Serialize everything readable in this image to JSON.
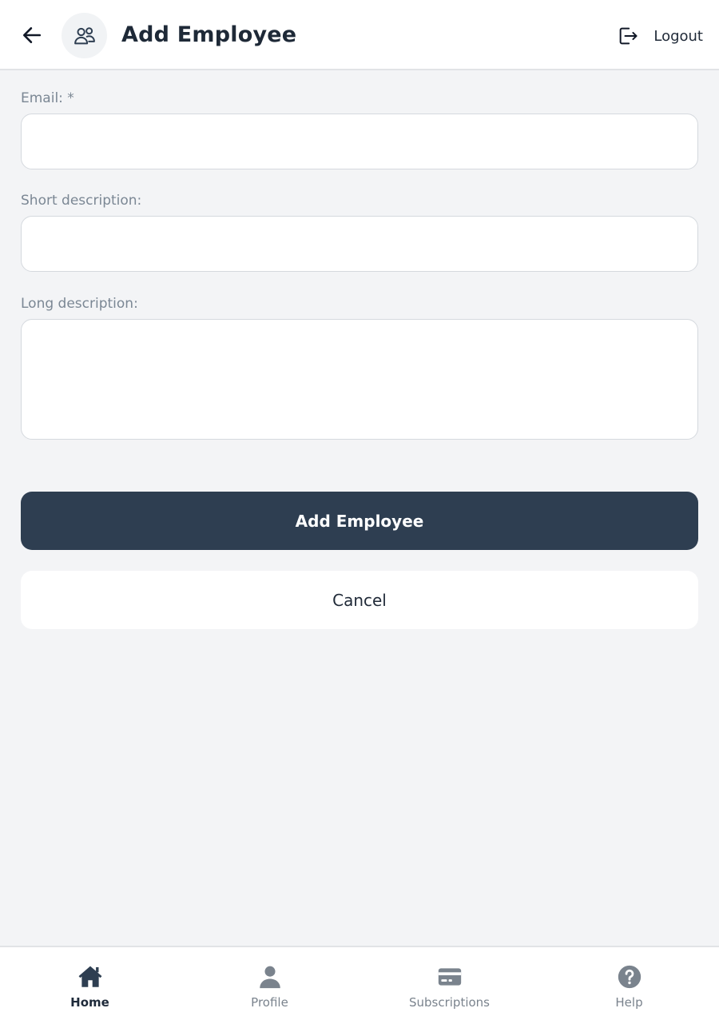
{
  "header": {
    "title": "Add Employee",
    "logout_label": "Logout"
  },
  "form": {
    "email_label": "Email: *",
    "email_value": "",
    "short_label": "Short description:",
    "short_value": "",
    "long_label": "Long description:",
    "long_value": ""
  },
  "actions": {
    "submit_label": "Add Employee",
    "cancel_label": "Cancel"
  },
  "nav": {
    "items": [
      {
        "label": "Home",
        "icon": "home-icon",
        "active": true
      },
      {
        "label": "Profile",
        "icon": "person-icon",
        "active": false
      },
      {
        "label": "Subscriptions",
        "icon": "card-icon",
        "active": false
      },
      {
        "label": "Help",
        "icon": "help-icon",
        "active": false
      }
    ]
  },
  "colors": {
    "primary": "#2e3e51",
    "background": "#f3f4f6",
    "active_nav": "#1e2a3a",
    "inactive_nav": "#7a838d"
  }
}
